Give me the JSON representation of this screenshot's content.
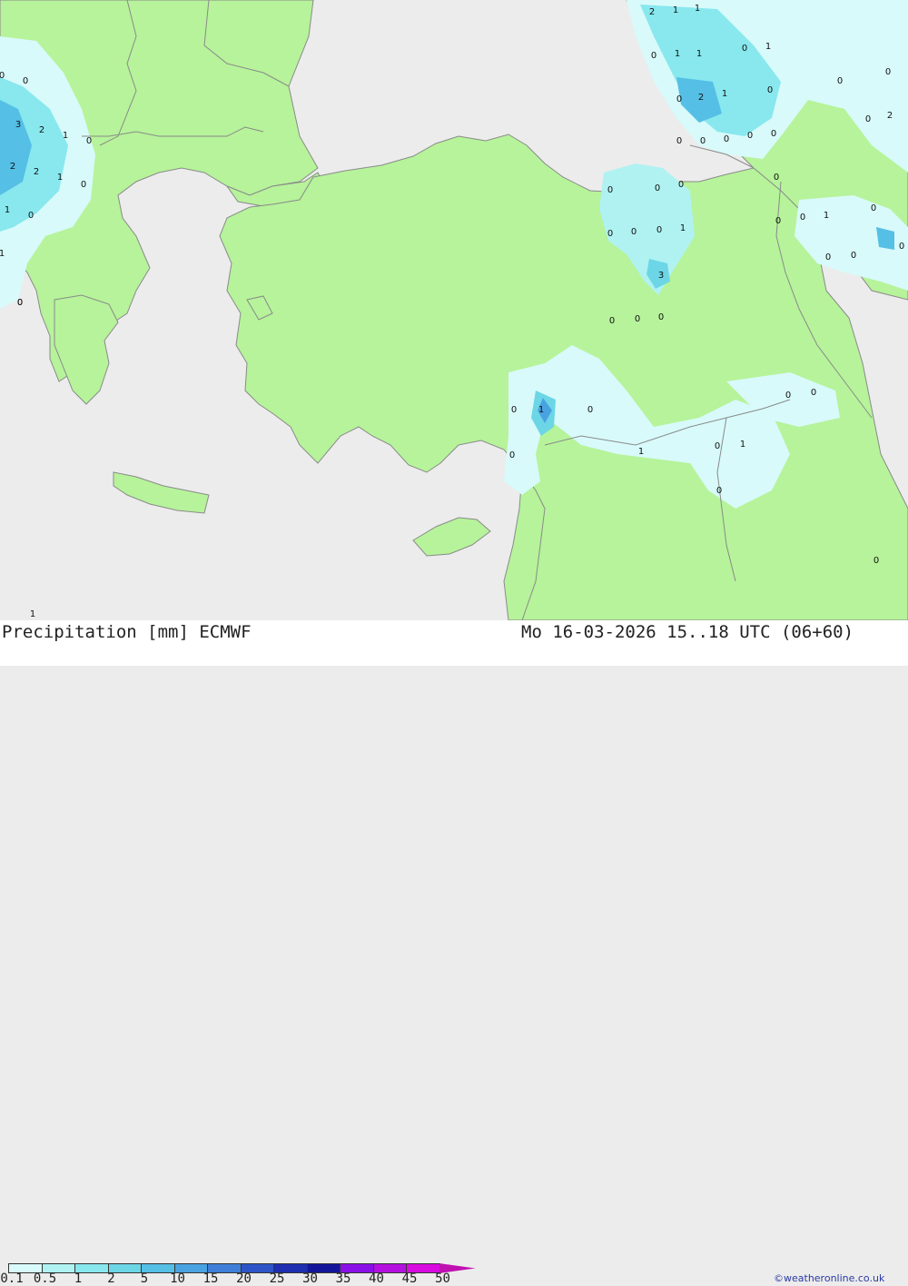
{
  "title": "Precipitation [mm] ECMWF",
  "valid_time": "Mo 16-03-2026 15..18 UTC (06+60)",
  "credit": "©weatheronline.co.uk",
  "legend": {
    "labels": [
      "0.1",
      "0.5",
      "1",
      "2",
      "5",
      "10",
      "15",
      "20",
      "25",
      "30",
      "35",
      "40",
      "45",
      "50"
    ],
    "colors": [
      "#d8fafa",
      "#b0f2f2",
      "#88e8ee",
      "#6cd6e6",
      "#55bfe6",
      "#4aa2e0",
      "#3f7fd8",
      "#2e55c8",
      "#1e2fb0",
      "#14169a",
      "#8a10e8",
      "#b410e0",
      "#d80ae0",
      "#c010b0"
    ]
  },
  "colors": {
    "land": "#b6f39a",
    "sea": "#ececec",
    "border": "#8a8a8a"
  },
  "map_values": [
    {
      "t": "2"
    },
    {
      "t": "1"
    },
    {
      "t": "1"
    },
    {
      "t": "0"
    },
    {
      "t": "1"
    },
    {
      "t": "1"
    },
    {
      "t": "0"
    },
    {
      "t": "1"
    },
    {
      "t": "0"
    },
    {
      "t": "0"
    },
    {
      "t": "0"
    },
    {
      "t": "2"
    },
    {
      "t": "1"
    },
    {
      "t": "0"
    },
    {
      "t": "0"
    },
    {
      "t": "0"
    },
    {
      "t": "0"
    },
    {
      "t": "0"
    },
    {
      "t": "0"
    },
    {
      "t": "0"
    },
    {
      "t": "2"
    },
    {
      "t": "0"
    },
    {
      "t": "0"
    },
    {
      "t": "0"
    },
    {
      "t": "3"
    },
    {
      "t": "2"
    },
    {
      "t": "1"
    },
    {
      "t": "0"
    },
    {
      "t": "2"
    },
    {
      "t": "2"
    },
    {
      "t": "1"
    },
    {
      "t": "0"
    },
    {
      "t": "1"
    },
    {
      "t": "0"
    },
    {
      "t": "1"
    },
    {
      "t": "0"
    },
    {
      "t": "0"
    },
    {
      "t": "0"
    },
    {
      "t": "0"
    },
    {
      "t": "0"
    },
    {
      "t": "0"
    },
    {
      "t": "0"
    },
    {
      "t": "1"
    },
    {
      "t": "0"
    },
    {
      "t": "0"
    },
    {
      "t": "1"
    },
    {
      "t": "0"
    },
    {
      "t": "0"
    },
    {
      "t": "0"
    },
    {
      "t": "0"
    },
    {
      "t": "3"
    },
    {
      "t": "0"
    },
    {
      "t": "0"
    },
    {
      "t": "0"
    },
    {
      "t": "0"
    },
    {
      "t": "0"
    },
    {
      "t": "0"
    },
    {
      "t": "1"
    },
    {
      "t": "0"
    },
    {
      "t": "1"
    },
    {
      "t": "0"
    },
    {
      "t": "1"
    },
    {
      "t": "0"
    },
    {
      "t": "1"
    },
    {
      "t": "0"
    },
    {
      "t": "0"
    },
    {
      "t": "0"
    }
  ]
}
